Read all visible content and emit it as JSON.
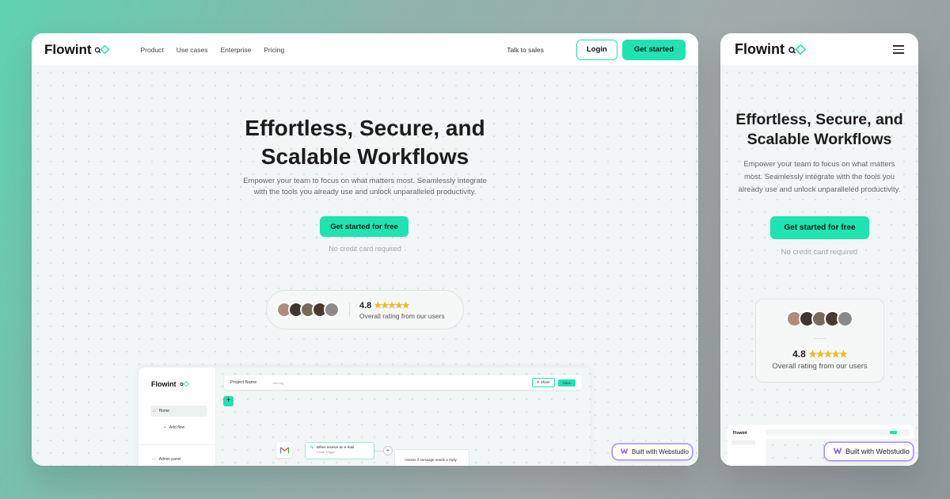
{
  "desktop": {
    "nav": {
      "logo": "Flowint",
      "links": [
        "Product",
        "Use cases",
        "Enterprise",
        "Pricing"
      ],
      "talk_to_sales": "Talk to sales",
      "login": "Login",
      "get_started": "Get started"
    },
    "hero": {
      "title_line1": "Effortless, Secure, and",
      "title_line2": "Scalable Workflows",
      "subtitle_line1": "Empower your team to focus on what matters most. Seamlessly integrate",
      "subtitle_line2": "with the tools you already use and unlock unparalleled productivity.",
      "cta": "Get started for free",
      "note": "No credit card required"
    },
    "rating": {
      "score": "4.8",
      "stars": "★★★★★",
      "text": "Overall rating from our users"
    },
    "preview": {
      "logo": "Flowint",
      "home": "Home",
      "add_flow": "Add flow",
      "admin_panel": "Admin panel",
      "project_name": "Project Name",
      "add_tag": "Add tag",
      "share": "Share",
      "save": "Save",
      "trigger_title": "When receive an e-mail",
      "trigger_sub": "Gmail Trigger",
      "assess": "Assess if message needs a reply"
    },
    "badge": "Built with Webstudio"
  },
  "mobile": {
    "nav": {
      "logo": "Flowint"
    },
    "hero": {
      "title_line1": "Effortless, Secure, and",
      "title_line2": "Scalable Workflows",
      "subtitle_line1": "Empower your team to focus on what matters",
      "subtitle_line2": "most. Seamlessly integrate with the tools you",
      "subtitle_line3": "already use and unlock unparalleled productivity.",
      "cta": "Get started for free",
      "note": "No credit card required"
    },
    "rating": {
      "score": "4.8",
      "stars": "★★★★★",
      "text": "Overall rating from our users"
    },
    "preview": {
      "logo": "Flowint"
    },
    "badge": "Built with Webstudio"
  },
  "colors": {
    "accent": "#1fe3b0",
    "star": "#f2b91a",
    "badge_border": "#a88cf0"
  },
  "icons": [
    "flowint-logo-icon",
    "hamburger-menu-icon",
    "star-icon",
    "home-icon",
    "plus-icon",
    "gmail-icon",
    "bolt-icon",
    "share-icon",
    "webstudio-icon"
  ]
}
